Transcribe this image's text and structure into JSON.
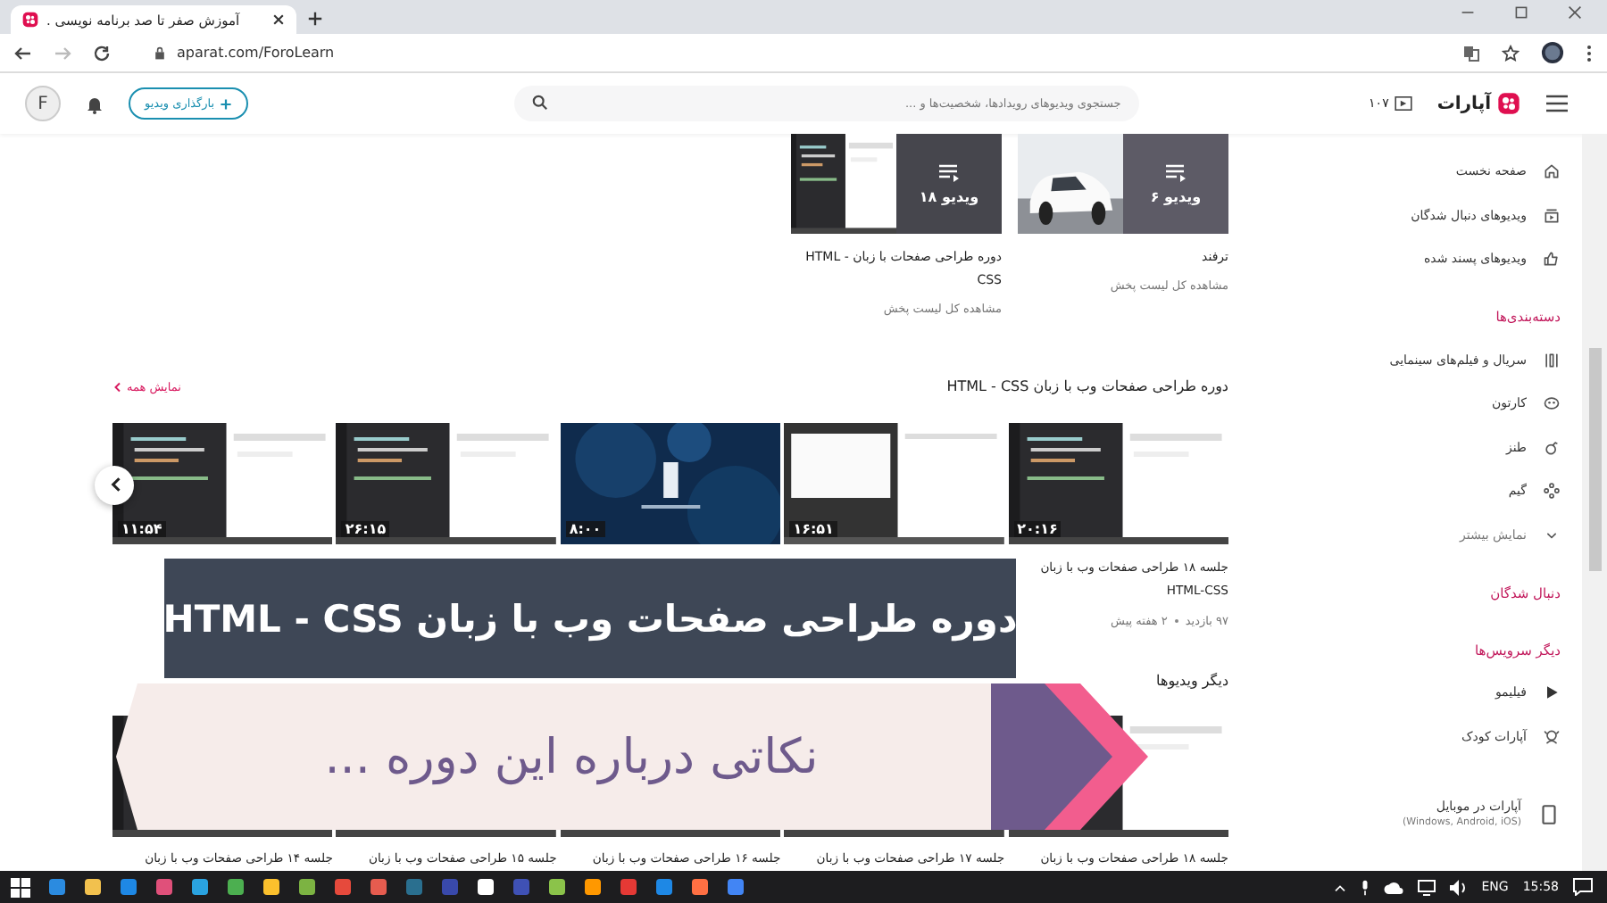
{
  "browser": {
    "tab_title": "آموزش صفر تا صد برنامه نویسی .",
    "url": "aparat.com/ForoLearn"
  },
  "header": {
    "logo": "آپارات",
    "count": "۱۰۷",
    "search_placeholder": "جستجوی ویدیوهای رویدادها، شخصیت‌ها و ...",
    "upload_button": "بارگذاری ویدیو",
    "avatar_letter": "F"
  },
  "sidebar": [
    {
      "items": [
        {
          "label": "صفحه نخست",
          "kind": "home"
        },
        {
          "label": "ویدیوهای دنبال شدگان",
          "kind": "subscriptions"
        },
        {
          "label": "ویدیوهای پسند شده",
          "kind": "liked"
        }
      ]
    },
    {
      "heading": "دسته‌بندی‌ها",
      "items": [
        {
          "label": "سریال و فیلم‌های سینمایی",
          "kind": "film"
        },
        {
          "label": "کارتون",
          "kind": "cartoon"
        },
        {
          "label": "طنز",
          "kind": "humor"
        },
        {
          "label": "گیم",
          "kind": "game"
        },
        {
          "label": "نمایش بیشتر",
          "kind": "more"
        }
      ]
    },
    {
      "heading": "دنبال شدگان"
    },
    {
      "heading": "دیگر سرویس‌ها",
      "items": [
        {
          "label": "فیلیمو",
          "kind": "filimo"
        },
        {
          "label": "آپارات کودک",
          "kind": "kids"
        }
      ]
    },
    {
      "items": [
        {
          "label": "آپارات در موبایل",
          "note": "(Windows, Android, iOS)",
          "kind": "mobile"
        }
      ]
    }
  ],
  "playlists": [
    {
      "title": "ترفند",
      "count": "۶ ویدیو",
      "link": "مشاهده کل لیست پخش"
    },
    {
      "title": "دوره طراحی صفحات با زبان HTML - CSS",
      "count": "۱۸ ویدیو",
      "link": "مشاهده کل لیست پخش"
    }
  ],
  "course_section": {
    "title": "دوره طراحی صفحات وب با زبان HTML - CSS",
    "show_all": "نمایش همه",
    "videos": [
      {
        "duration": "۲۰:۱۶",
        "title": "جلسه ۱۸ طراحی صفحات وب با زبان HTML-CSS",
        "views": "۹۷ بازدید",
        "age": "۲ هفته پیش"
      },
      {
        "duration": "۱۶:۵۱"
      },
      {
        "duration": "۸:۰۰"
      },
      {
        "duration": "۲۶:۱۵"
      },
      {
        "duration": "۱۱:۵۴"
      }
    ]
  },
  "other_section": {
    "title": "دیگر ویدیوها",
    "videos": [
      {
        "title": "جلسه ۱۸ طراحی صفحات وب با زبان"
      },
      {
        "title": "جلسه ۱۷ طراحی صفحات وب با زبان"
      },
      {
        "title": "جلسه ۱۶ طراحی صفحات وب با زبان"
      },
      {
        "title": "جلسه ۱۵ طراحی صفحات وب با زبان"
      },
      {
        "title": "جلسه ۱۴ طراحی صفحات وب با زبان"
      }
    ]
  },
  "overlay": {
    "title": "دوره طراحی صفحات وب با زبان HTML - CSS",
    "subtitle": "نکاتی درباره این دوره ..."
  },
  "taskbar": {
    "language": "ENG",
    "time": "15:58"
  }
}
